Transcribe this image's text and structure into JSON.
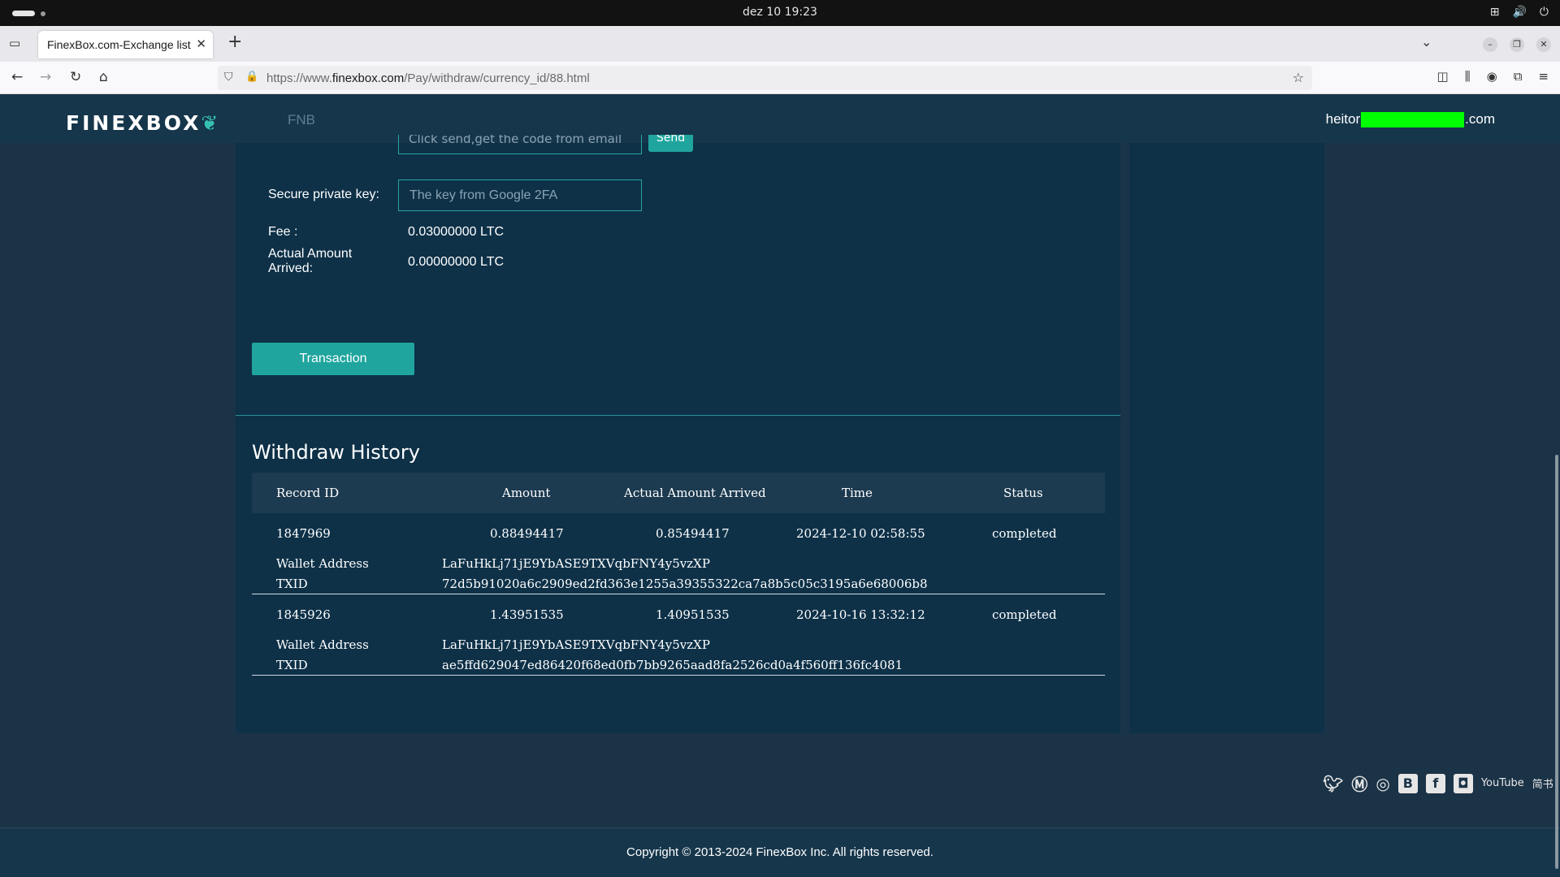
{
  "os": {
    "clock": "dez 10  19:23"
  },
  "browser": {
    "tab_title": "FinexBox.com-Exchange list",
    "url_prefix": "https://www.",
    "url_domain": "finexbox.com",
    "url_path": "/Pay/withdraw/currency_id/88.html"
  },
  "header": {
    "logo_text": "FINEXBOX",
    "nav_fnb": "FNB",
    "user_email_prefix": "heitor",
    "user_email_suffix": ".com"
  },
  "form": {
    "email_code_placeholder": "Click send,get the code from email",
    "send_label": "Send",
    "secure_key_label": "Secure private key:",
    "secure_key_placeholder": "The key from Google 2FA",
    "fee_label": "Fee :",
    "fee_value": "0.03000000 LTC",
    "actual_label": "Actual Amount Arrived:",
    "actual_value": "0.00000000 LTC",
    "transaction_button": "Transaction"
  },
  "history": {
    "title": "Withdraw History",
    "columns": [
      "Record ID",
      "Amount",
      "Actual Amount Arrived",
      "Time",
      "Status"
    ],
    "wallet_label": "Wallet Address",
    "txid_label": "TXID",
    "records": [
      {
        "id": "1847969",
        "amount": "0.88494417",
        "actual": "0.85494417",
        "time": "2024-12-10 02:58:55",
        "status": "completed",
        "wallet": "LaFuHkLj71jE9YbASE9TXVqbFNY4y5vzXP",
        "txid": "72d5b91020a6c2909ed2fd363e1255a39355322ca7a8b5c05c3195a6e68006b8"
      },
      {
        "id": "1845926",
        "amount": "1.43951535",
        "actual": "1.40951535",
        "time": "2024-10-16 13:32:12",
        "status": "completed",
        "wallet": "LaFuHkLj71jE9YbASE9TXVqbFNY4y5vzXP",
        "txid": "ae5ffd629047ed86420f68ed0fb7bb9265aad8fa2526cd0a4f560ff136fc4081"
      }
    ]
  },
  "social": {
    "youtube": "YouTube",
    "jianshu": "简书"
  },
  "footer": {
    "copyright": "Copyright © 2013-2024 FinexBox Inc. All rights reserved."
  },
  "colors": {
    "page_bg": "#1b3347",
    "panel_bg": "#0e3148",
    "accent": "#1fa59e",
    "header_bg": "#16364b"
  }
}
